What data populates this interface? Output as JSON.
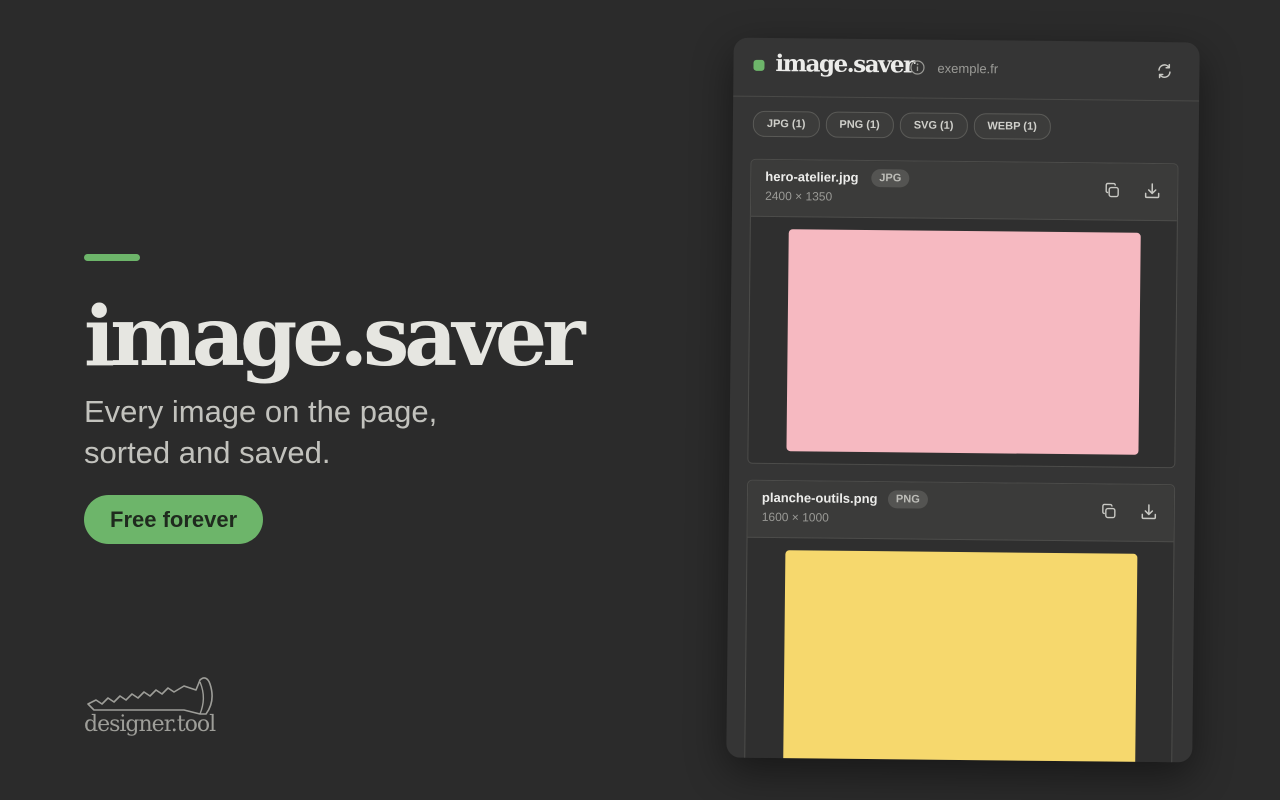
{
  "hero": {
    "title": "image.saver",
    "tagline": "Every image on the page, sorted and saved.",
    "cta_label": "Free forever",
    "accent_color": "#6db56a"
  },
  "brand": {
    "name": "designer.tool",
    "icon": "screw-icon"
  },
  "panel": {
    "app_name": "image.saver",
    "site_host": "exemple.fr",
    "status_color": "#6db56a",
    "icons": [
      "info-icon",
      "refresh-icon"
    ],
    "filters": [
      {
        "label": "JPG (1)"
      },
      {
        "label": "PNG (1)"
      },
      {
        "label": "SVG (1)"
      },
      {
        "label": "WEBP (1)"
      }
    ],
    "images": [
      {
        "file_name": "hero-atelier.jpg",
        "type": "JPG",
        "dimensions": "2400 × 1350",
        "preview_color": "#f6b9c1",
        "actions": [
          "copy-icon",
          "download-icon"
        ]
      },
      {
        "file_name": "planche-outils.png",
        "type": "PNG",
        "dimensions": "1600 × 1000",
        "preview_color": "#f6d86d",
        "actions": [
          "copy-icon",
          "download-icon"
        ]
      }
    ]
  }
}
